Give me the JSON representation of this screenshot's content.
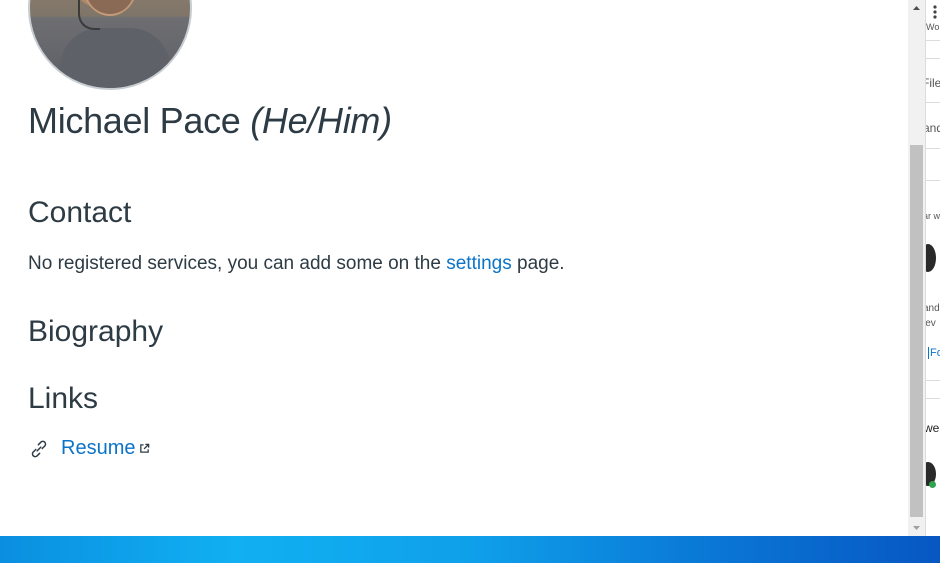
{
  "profile": {
    "name": "Michael Pace",
    "pronouns": "(He/Him)"
  },
  "contact": {
    "heading": "Contact",
    "text_before": "No registered services, you can add some on the ",
    "link_label": "settings",
    "text_after": " page."
  },
  "biography": {
    "heading": "Biography"
  },
  "links": {
    "heading": "Links",
    "items": [
      {
        "label": "Resume",
        "icon": "chain-link-icon",
        "external_icon": "external-link-icon"
      }
    ]
  },
  "right_panel_fragments": {
    "item_1": "Wo",
    "item_2": "Files",
    "item_3": "and",
    "item_4": "ar w",
    "item_5": "and",
    "item_6": "iev",
    "item_7": "Fo",
    "item_8": "we"
  },
  "colors": {
    "text": "#2d3b45",
    "link": "#0b74c9",
    "taskbar": "#0a78d6"
  }
}
